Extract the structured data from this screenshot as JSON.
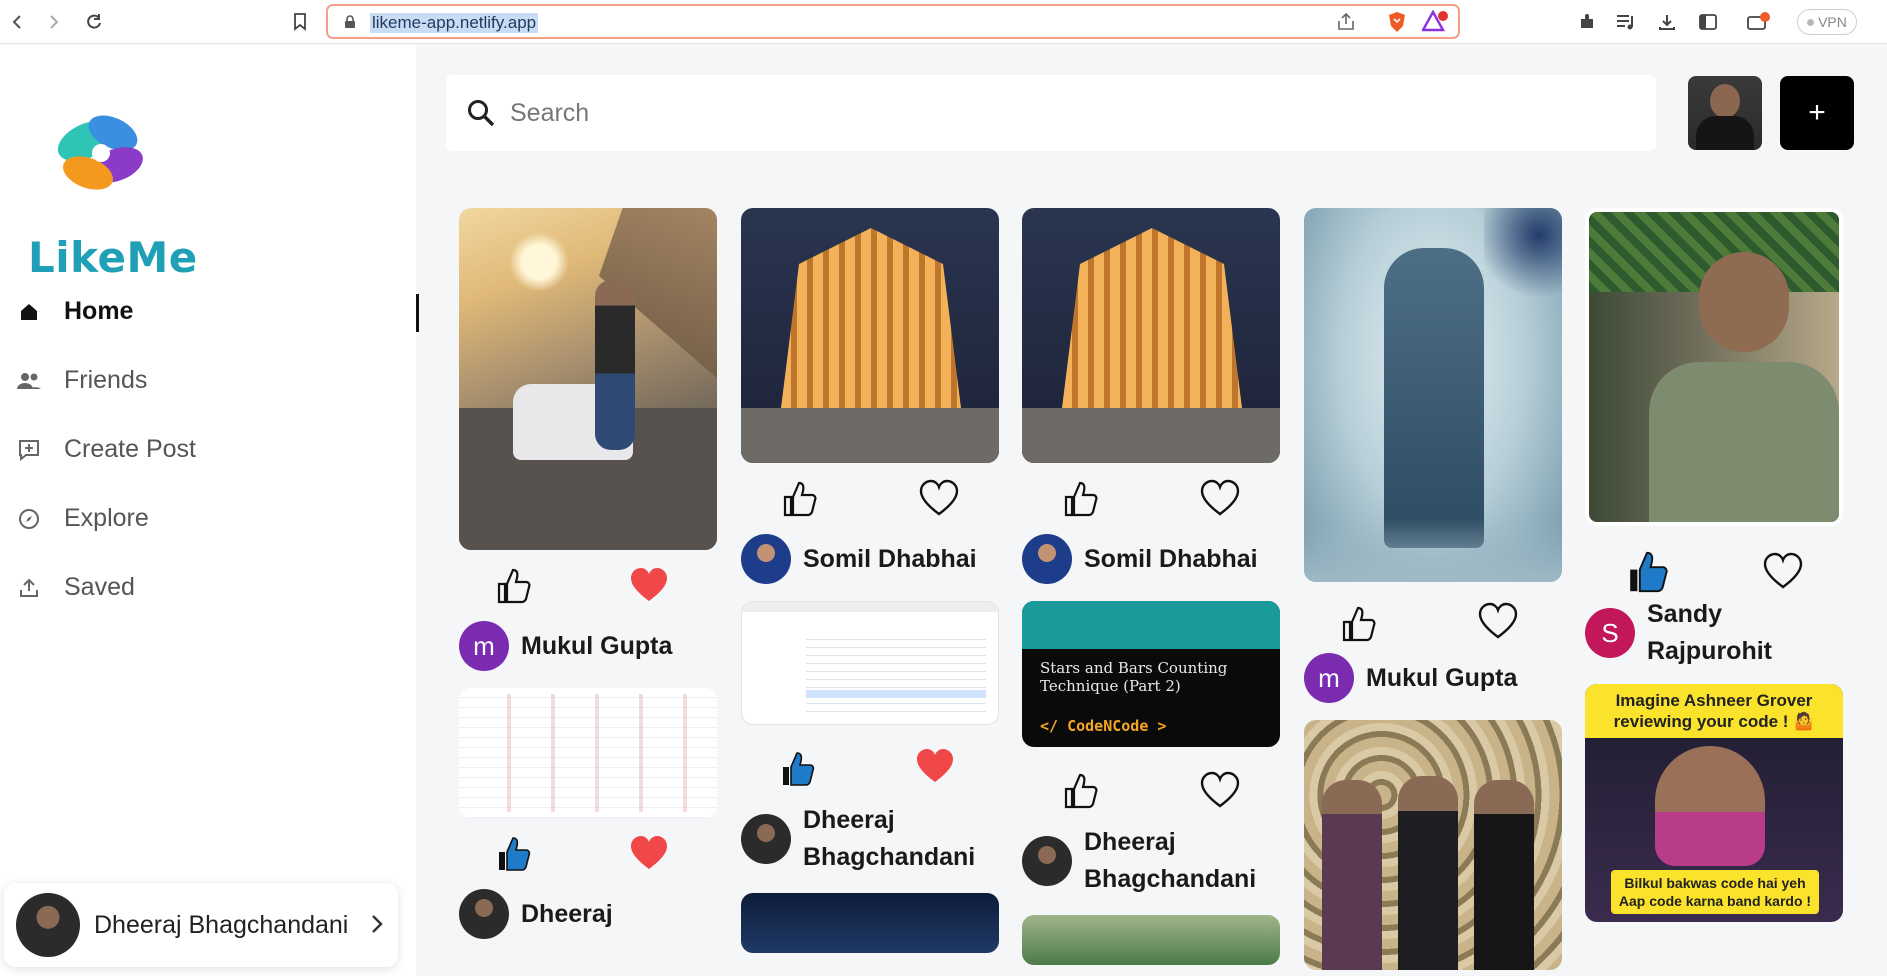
{
  "browser": {
    "url": "likeme-app.netlify.app",
    "vpn_label": "VPN"
  },
  "sidebar": {
    "brand": "LikeMe",
    "items": [
      {
        "label": "Home",
        "icon": "home-icon",
        "active": true
      },
      {
        "label": "Friends",
        "icon": "friends-icon",
        "active": false
      },
      {
        "label": "Create Post",
        "icon": "create-post-icon",
        "active": false
      },
      {
        "label": "Explore",
        "icon": "explore-icon",
        "active": false
      },
      {
        "label": "Saved",
        "icon": "saved-icon",
        "active": false
      }
    ],
    "profile": {
      "name": "Dheeraj Bhagchandani"
    }
  },
  "header": {
    "search_placeholder": "Search",
    "add_label": "+"
  },
  "feed": {
    "col1": {
      "post1_user": "Mukul Gupta",
      "post1_avatar_letter": "m",
      "post2_user": "Dheeraj"
    },
    "col2": {
      "post1_user": "Somil Dhabhai",
      "post2_user": "Dheeraj Bhagchandani"
    },
    "col3": {
      "post1_user": "Somil Dhabhai",
      "post2_user": "Dheeraj Bhagchandani",
      "code_card_title": "Stars and Bars Counting Technique (Part 2)",
      "code_card_brand": "</ CodeNCode >"
    },
    "col4": {
      "post1_user": "Mukul Gupta",
      "post1_avatar_letter": "m"
    },
    "col5": {
      "post1_user": "Sandy Rajpurohit",
      "post1_avatar_letter": "S",
      "meme_top": "Imagine Ashneer Grover reviewing your code ! 🤷",
      "meme_bottom": "Bilkul bakwas code hai yeh Aap code karna band kardo !"
    }
  },
  "colors": {
    "like_active": "#1f7bc8",
    "heart_active": "#f04848",
    "avatar_purple": "#7b2bb0",
    "avatar_pink": "#c2185b",
    "brand_teal": "#1fa0b6"
  }
}
